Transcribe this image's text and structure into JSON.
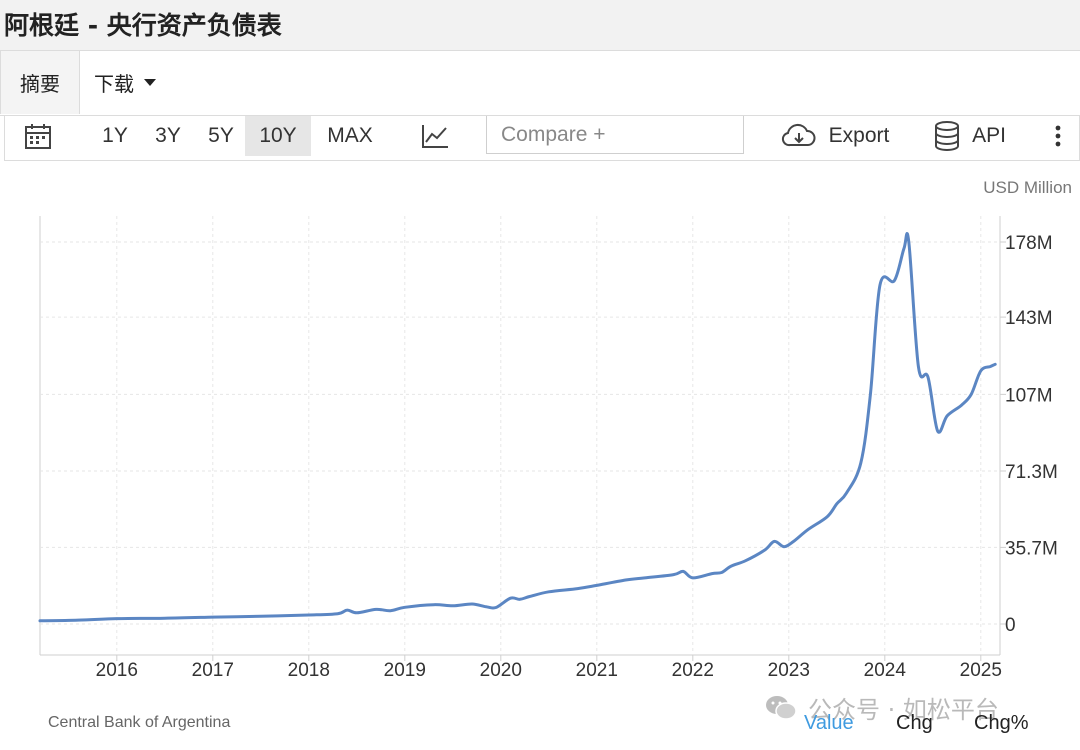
{
  "header": {
    "title": "阿根廷 - 央行资产负债表"
  },
  "tabs": [
    {
      "label": "摘要"
    },
    {
      "label": "下载"
    }
  ],
  "toolbar": {
    "ranges": [
      "1Y",
      "3Y",
      "5Y",
      "10Y",
      "MAX"
    ],
    "selected_range": "10Y",
    "compare_placeholder": "Compare +",
    "export_label": "Export",
    "api_label": "API",
    "icons": [
      "calendar-icon",
      "line-chart-icon",
      "cloud-download-icon",
      "database-icon",
      "more-vert-icon"
    ]
  },
  "chart_data": {
    "type": "line",
    "unit": "USD Million",
    "x_tick_labels": [
      "2016",
      "2017",
      "2018",
      "2019",
      "2020",
      "2021",
      "2022",
      "2023",
      "2024",
      "2025"
    ],
    "y_tick_labels": [
      "0",
      "35.7M",
      "71.3M",
      "107M",
      "143M",
      "178M"
    ],
    "ylim": [
      0,
      178
    ],
    "xlim": [
      2015.2,
      2025.2
    ],
    "grid": true,
    "series": [
      {
        "color": "#5b86c3",
        "x": [
          2015.2,
          2015.6,
          2016.0,
          2016.5,
          2017.0,
          2017.5,
          2018.0,
          2018.3,
          2018.4,
          2018.5,
          2018.7,
          2018.85,
          2019.0,
          2019.3,
          2019.5,
          2019.7,
          2019.85,
          2019.95,
          2020.1,
          2020.2,
          2020.3,
          2020.5,
          2020.8,
          2021.0,
          2021.3,
          2021.5,
          2021.8,
          2021.9,
          2022.0,
          2022.2,
          2022.3,
          2022.4,
          2022.55,
          2022.75,
          2022.85,
          2022.95,
          2023.05,
          2023.2,
          2023.4,
          2023.5,
          2023.6,
          2023.75,
          2023.85,
          2023.95,
          2024.1,
          2024.2,
          2024.25,
          2024.35,
          2024.45,
          2024.55,
          2024.65,
          2024.8,
          2024.9,
          2025.0,
          2025.1,
          2025.15
        ],
        "y": [
          1.5,
          1.8,
          2.5,
          2.7,
          3.2,
          3.6,
          4.2,
          4.8,
          6.5,
          5.2,
          6.8,
          6.2,
          7.8,
          9.0,
          8.5,
          9.3,
          8.0,
          7.7,
          12.0,
          11.5,
          12.8,
          15.0,
          16.5,
          18.0,
          20.5,
          21.5,
          23.0,
          24.5,
          21.5,
          23.5,
          24.0,
          27.0,
          29.5,
          34.5,
          38.5,
          36.0,
          38.5,
          44.0,
          50.0,
          56.0,
          61.0,
          75.0,
          107.0,
          158.0,
          160.0,
          175.0,
          178.0,
          120.0,
          115.0,
          90.0,
          97.0,
          102.0,
          107.0,
          118.0,
          120.0,
          121.0
        ]
      }
    ]
  },
  "source": "Central Bank of Argentina",
  "legend": {
    "value_label": "Value",
    "chg_label": "Chg",
    "chgp_label": "Chg%",
    "value_color": "#3f9be0"
  },
  "watermark": "公众号 · 如松平台"
}
